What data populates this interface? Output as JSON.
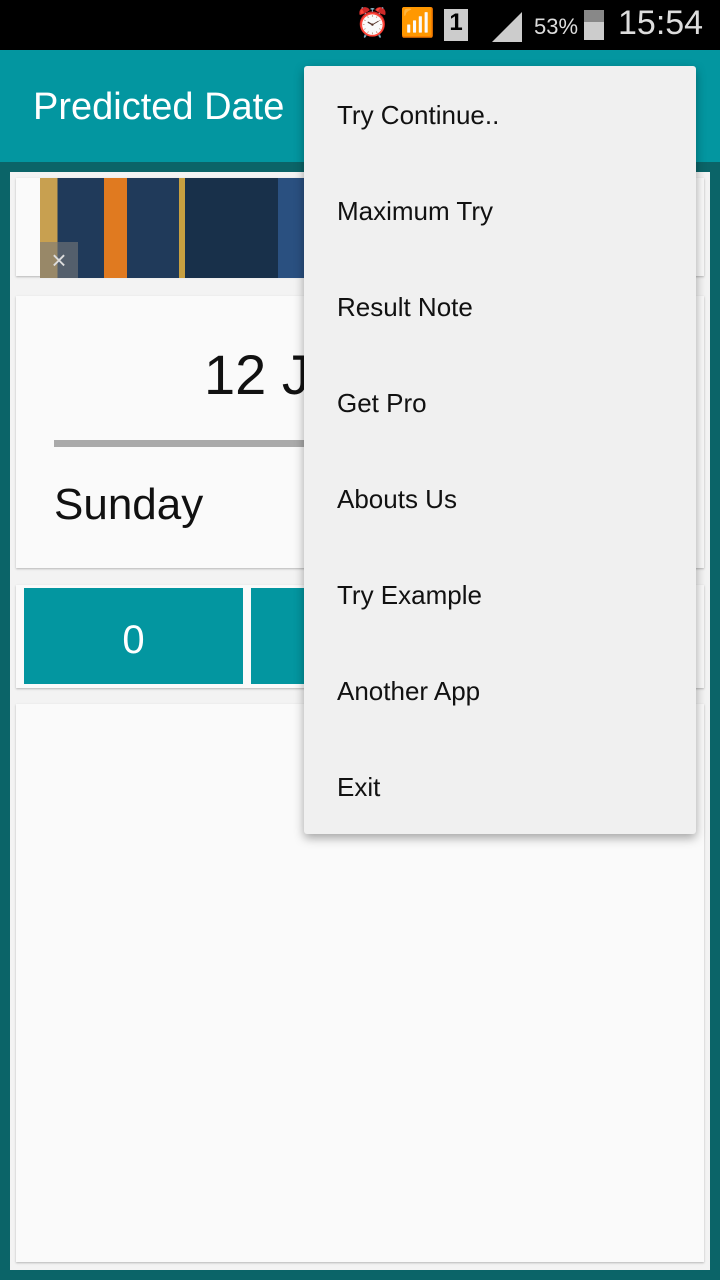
{
  "status_bar": {
    "battery": "53%",
    "time": "15:54",
    "icons": [
      "alarm-icon",
      "wifi-icon",
      "sim-1-icon",
      "signal-icon",
      "battery-icon"
    ]
  },
  "app_bar": {
    "title": "Predicted Date"
  },
  "result": {
    "date": "12 J",
    "day": "Sunday"
  },
  "buttons": [
    {
      "label": "0"
    },
    {
      "label": ""
    }
  ],
  "menu": {
    "items": [
      "Try Continue..",
      "Maximum Try",
      "Result Note",
      "Get Pro",
      "Abouts Us",
      "Try Example",
      "Another App",
      "Exit"
    ]
  },
  "colors": {
    "primary": "#0396a0",
    "background": "#0b6468"
  }
}
